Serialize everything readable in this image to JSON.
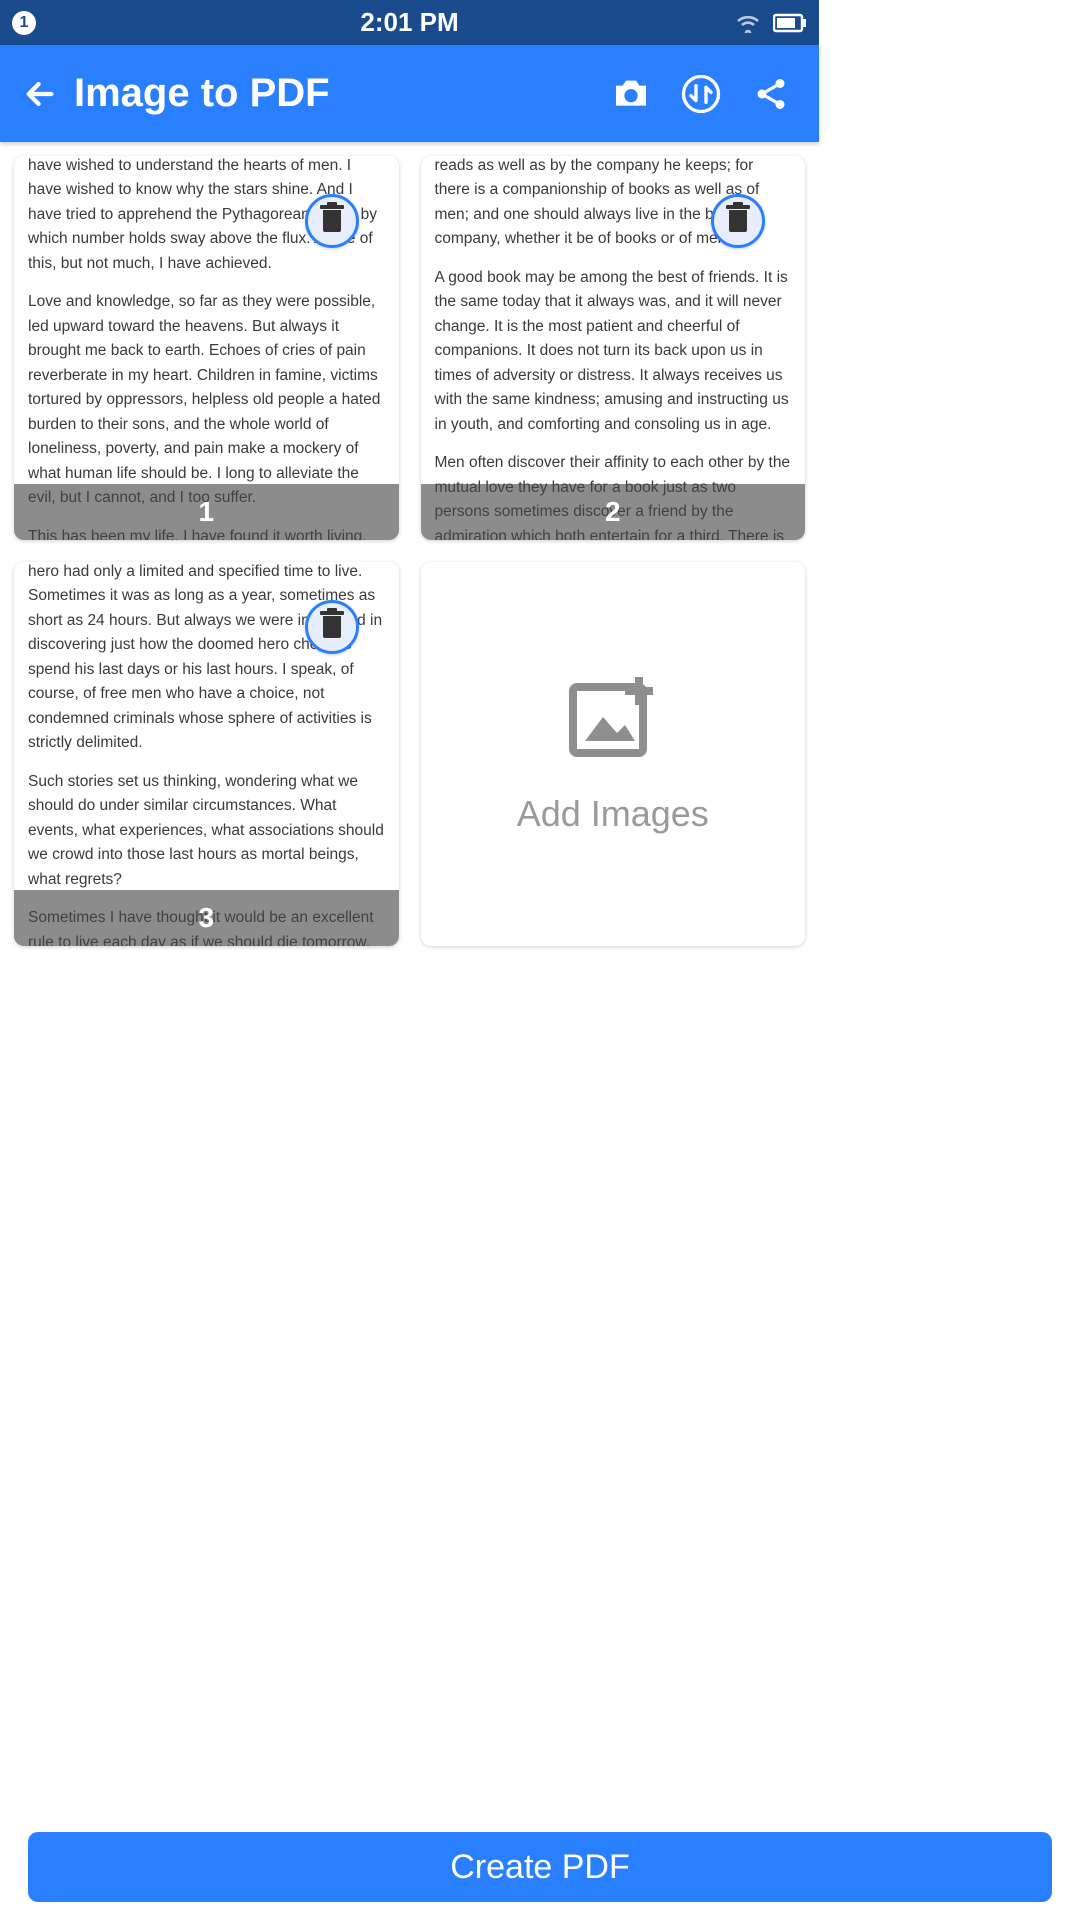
{
  "status": {
    "notif_count": "1",
    "time": "2:01 PM"
  },
  "header": {
    "title": "Image to PDF"
  },
  "pages": [
    {
      "index": "1",
      "para_top": "have wished to understand the hearts of men. I have wished to know why the stars shine. And I have tried to apprehend the Pythagorean power by which number holds sway above the flux. A little of this, but not much, I have achieved.",
      "para_mid": "Love and knowledge, so far as they were possible, led upward toward the heavens. But always it brought me back to earth. Echoes of cries of pain reverberate in my heart. Children in famine, victims tortured by oppressors, helpless old people a hated burden to their sons, and the whole world of loneliness, poverty, and pain make a mockery of what human life should be. I long to alleviate the evil, but I cannot, and I too suffer.",
      "para_bot": "This has been my life. I have found it worth living, and would gladly live it again if the"
    },
    {
      "index": "2",
      "para_top": "reads as well as by the company he keeps; for there is a companionship of books as well as of men; and one should always live in the best company, whether it be of books or of men.",
      "para_mid": "A good book may be among the best of friends. It is the same today that it always was, and it will never change. It is the most patient and cheerful of companions. It does not turn its back upon us in times of adversity or distress. It always receives us with the same kindness; amusing and instructing us in youth, and comforting and consoling us in age.",
      "para_bot": "Men often discover their affinity to each other by the mutual love they have for a book just as two persons sometimes discover a friend by the admiration which both entertain for a third. There is an old proverb, \"Love me, love my dog.\" But there is more wisdom in this: \"Love"
    },
    {
      "index": "3",
      "para_top": "hero had only a limited and specified time to live. Sometimes it was as long as a year, sometimes as short as 24 hours. But always we were interested in discovering just how the doomed hero chose to spend his last days or his last hours. I speak, of course, of free men who have a choice, not condemned criminals whose sphere of activities is strictly delimited.",
      "para_mid": "Such stories set us thinking, wondering what we should do under similar circumstances. What events, what experiences, what associations should we crowd into those last hours as mortal beings, what regrets?",
      "para_bot": "Sometimes I have thought it would be an excellent rule to live each day as if we should die tomorrow. Such an attitude would emphasize sharply the values of life. We should live each day with gentleness, vigor and a"
    }
  ],
  "add_images_label": "Add Images",
  "create_button": "Create PDF"
}
